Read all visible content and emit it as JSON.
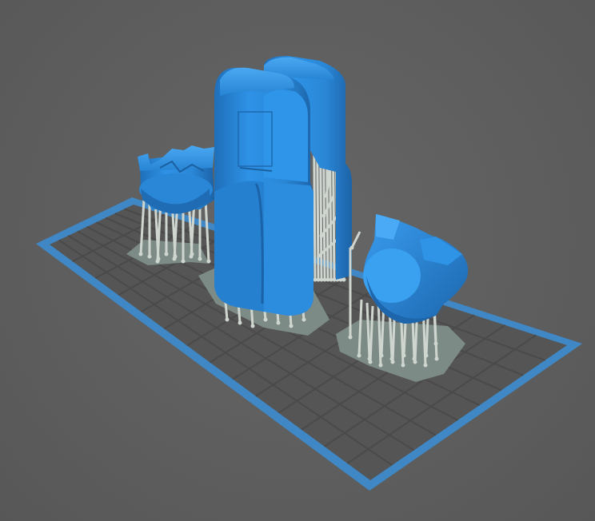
{
  "scene": {
    "type": "3d-print-slicer-viewport",
    "background_color": "#5e5e5e",
    "build_plate": {
      "border_color": "#3f88c5",
      "grid_color": "#4d4d4d",
      "raft_color": "#7d8b87"
    },
    "models": [
      {
        "name": "small-tank-part",
        "color": "#2c8fe0"
      },
      {
        "name": "tall-tower-part",
        "color": "#2c8fe0"
      },
      {
        "name": "bowl-part",
        "color": "#2c8fe0"
      }
    ],
    "supports": {
      "color": "#cfd6d0"
    }
  }
}
